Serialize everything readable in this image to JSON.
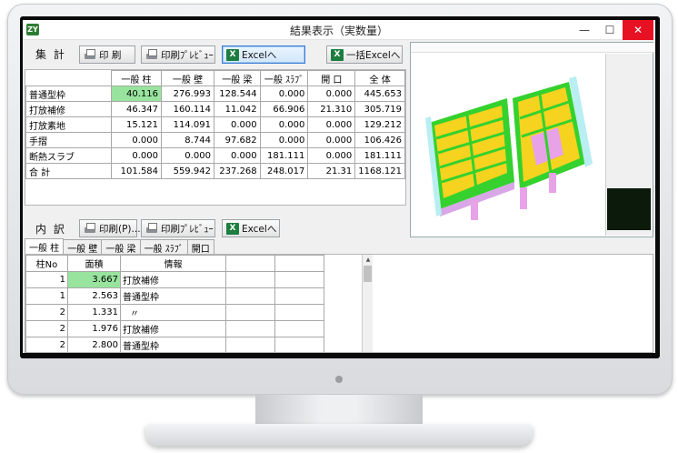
{
  "window": {
    "title": "結果表示（実数量）",
    "minimize": "—",
    "maximize": "☐",
    "close": "✕",
    "logo": "ZY"
  },
  "summary": {
    "label": "集 計",
    "buttons": {
      "print": "印 刷",
      "preview": "印刷ﾌﾟﾚﾋﾞｭｰ",
      "excel": "Excelへ",
      "batch_excel": "一括Excelへ"
    },
    "columns": [
      "一般 柱",
      "一般 壁",
      "一般 梁",
      "一般 ｽﾗﾌﾞ",
      "開 口",
      "全 体"
    ],
    "rows": [
      {
        "name": "普通型枠",
        "values": [
          "40.116",
          "276.993",
          "128.544",
          "0.000",
          "0.000",
          "445.653"
        ]
      },
      {
        "name": "打放補修",
        "values": [
          "46.347",
          "160.114",
          "11.042",
          "66.906",
          "21.310",
          "305.719"
        ]
      },
      {
        "name": "打放素地",
        "values": [
          "15.121",
          "114.091",
          "0.000",
          "0.000",
          "0.000",
          "129.212"
        ]
      },
      {
        "name": "手摺",
        "values": [
          "0.000",
          "8.744",
          "97.682",
          "0.000",
          "0.000",
          "106.426"
        ]
      },
      {
        "name": "断熱スラブ",
        "values": [
          "0.000",
          "0.000",
          "0.000",
          "181.111",
          "0.000",
          "181.111"
        ]
      },
      {
        "name": "合 計",
        "values": [
          "101.584",
          "559.942",
          "237.268",
          "248.017",
          "21.31",
          "1168.121"
        ]
      }
    ]
  },
  "detail": {
    "label": "内 訳",
    "buttons": {
      "print": "印刷(P)...",
      "preview": "印刷ﾌﾟﾚﾋﾞｭｰ",
      "excel": "Excelへ"
    },
    "tabs": [
      "一般 柱",
      "一般 壁",
      "一般 梁",
      "一般 ｽﾗﾌﾞ",
      "開口"
    ],
    "columns": [
      "柱No",
      "面積",
      "情報",
      "",
      ""
    ],
    "rows": [
      {
        "no": "1",
        "area": "3.667",
        "info": "打放補修"
      },
      {
        "no": "1",
        "area": "2.563",
        "info": "普通型枠"
      },
      {
        "no": "2",
        "area": "1.331",
        "info": "〃"
      },
      {
        "no": "2",
        "area": "1.976",
        "info": "打放補修"
      },
      {
        "no": "2",
        "area": "2.800",
        "info": "普通型枠"
      }
    ]
  },
  "colors": {
    "highlight_green": "#98e49e",
    "close_red": "#e81123",
    "slab_yellow": "#f5d31f",
    "beam_green": "#35d12e",
    "wall_cyan": "#b9eef2",
    "pink": "#e8a2e8"
  }
}
